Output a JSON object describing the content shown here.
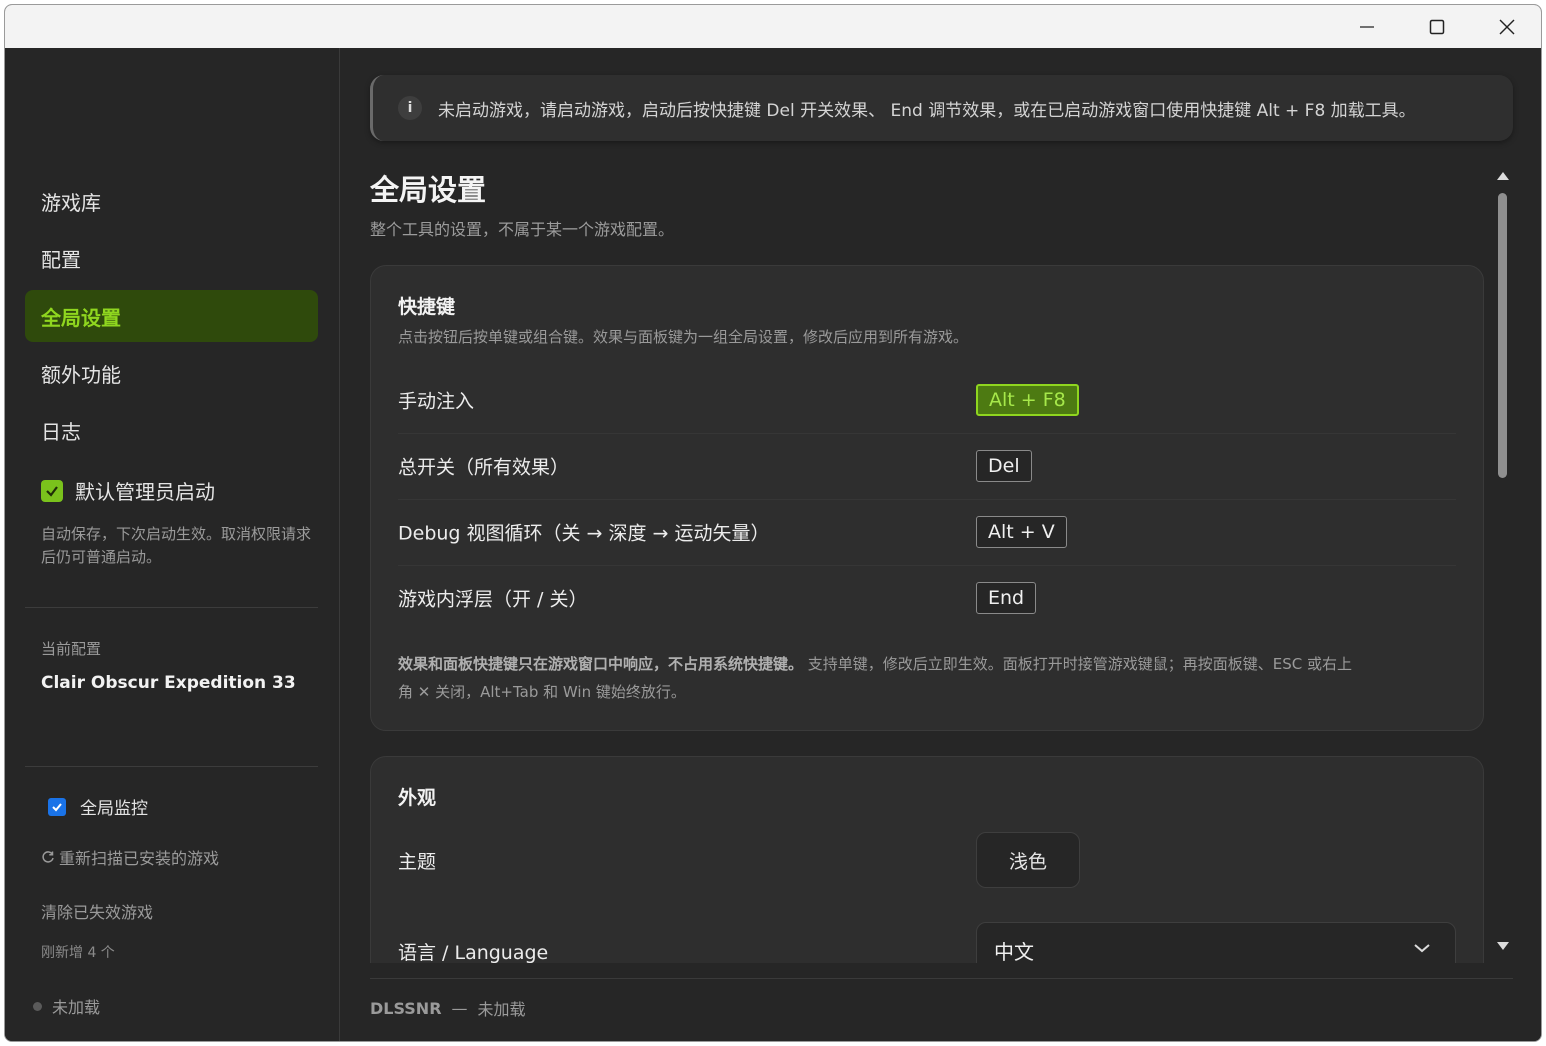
{
  "window": {
    "minimize_icon": "minimize-icon",
    "maximize_icon": "maximize-icon",
    "close_icon": "close-icon"
  },
  "sidebar": {
    "items": [
      {
        "label": "游戏库",
        "active": false
      },
      {
        "label": "配置",
        "active": false
      },
      {
        "label": "全局设置",
        "active": true
      },
      {
        "label": "额外功能",
        "active": false
      },
      {
        "label": "日志",
        "active": false
      }
    ],
    "admin_checkbox": {
      "label": "默认管理员启动",
      "checked": true
    },
    "admin_hint": "自动保存，下次启动生效。取消权限请求后仍可普通启动。",
    "current_config_label": "当前配置",
    "current_config_value": "Clair Obscur Expedition 33",
    "global_monitor": {
      "label": "全局监控",
      "checked": true
    },
    "rescan_label": "重新扫描已安装的游戏",
    "clear_label": "清除已失效游戏",
    "new_count": "刚新增 4 个",
    "status": "未加载"
  },
  "banner": {
    "icon": "i",
    "text": "未启动游戏，请启动游戏，启动后按快捷键 Del 开关效果、 End 调节效果，或在已启动游戏窗口使用快捷键 Alt + F8 加载工具。"
  },
  "page": {
    "title": "全局设置",
    "subtitle": "整个工具的设置，不属于某一个游戏配置。"
  },
  "hotkeys": {
    "title": "快捷键",
    "desc": "点击按钮后按单键或组合键。效果与面板键为一组全局设置，修改后应用到所有游戏。",
    "rows": [
      {
        "label": "手动注入",
        "key": "Alt + F8",
        "active": true
      },
      {
        "label": "总开关（所有效果）",
        "key": "Del",
        "active": false
      },
      {
        "label": "Debug 视图循环（关 → 深度 → 运动矢量）",
        "key": "Alt + V",
        "active": false
      },
      {
        "label": "游戏内浮层（开 / 关）",
        "key": "End",
        "active": false
      }
    ],
    "note_bold": "效果和面板快捷键只在游戏窗口中响应，不占用系统快捷键。",
    "note_rest_line1": "支持单键，修改后立即生效。面板打开时接管游戏键鼠；再按面板键、ESC 或右上",
    "note_line2": "角 ✕ 关闭，Alt+Tab 和 Win 键始终放行。"
  },
  "appearance": {
    "title": "外观",
    "theme_label": "主题",
    "theme_value": "浅色",
    "language_label": "语言 / Language",
    "language_value": "中文"
  },
  "footer": {
    "app": "DLSSNR",
    "sep": "—",
    "status": "未加载"
  },
  "colors": {
    "accent": "#8fd61f",
    "active_bg": "#2f4a0c",
    "bg": "#262626",
    "card": "#2e2e2e"
  }
}
